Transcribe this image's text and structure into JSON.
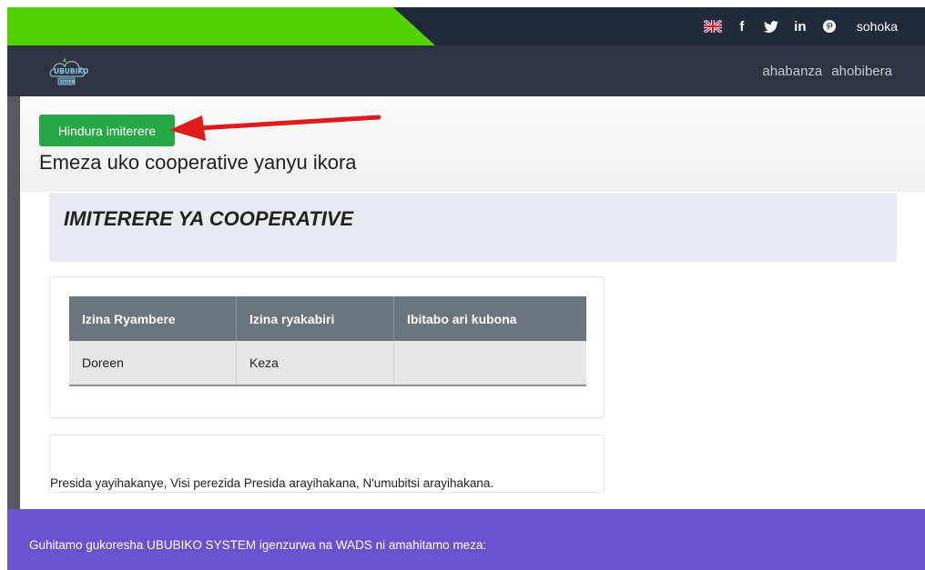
{
  "topbar": {
    "social": {
      "flag_icon": "uk-flag-icon",
      "facebook_glyph": "f",
      "twitter_glyph": "twitter-bird-icon",
      "linkedin_glyph": "in",
      "pinterest_glyph": "pinterest-icon",
      "logout_label": "sohoka"
    }
  },
  "navbar": {
    "logo_text": "UBUBIKO",
    "logo_sub": "SYSTEM",
    "links": [
      "ahabanza",
      "ahobibera"
    ]
  },
  "header": {
    "edit_button_label": "Hindura imiterere",
    "page_title": "Emeza uko cooperative yanyu ikora"
  },
  "jumbotron": {
    "heading": "IMITERERE YA COOPERATIVE"
  },
  "members_table": {
    "columns": [
      "Izina Ryambere",
      "Izina ryakabiri",
      "Ibitabo ari kubona"
    ],
    "rows": [
      [
        "Doreen",
        "Keza",
        ""
      ]
    ]
  },
  "note": {
    "text": "Presida yayihakanye, Visi perezida Presida arayihakana, N'umubitsi arayihakana."
  },
  "footer": {
    "text": "Guhitamo gukoresha UBUBIKO SYSTEM igenzurwa na WADS ni amahitamo meza:"
  },
  "colors": {
    "topbar_bg": "#212a38",
    "topbar_accent": "#54d200",
    "navbar_bg": "#2f3440",
    "button_green": "#28a745",
    "footer_bg": "#6a51cd",
    "arrow_red": "#e01b1b"
  }
}
